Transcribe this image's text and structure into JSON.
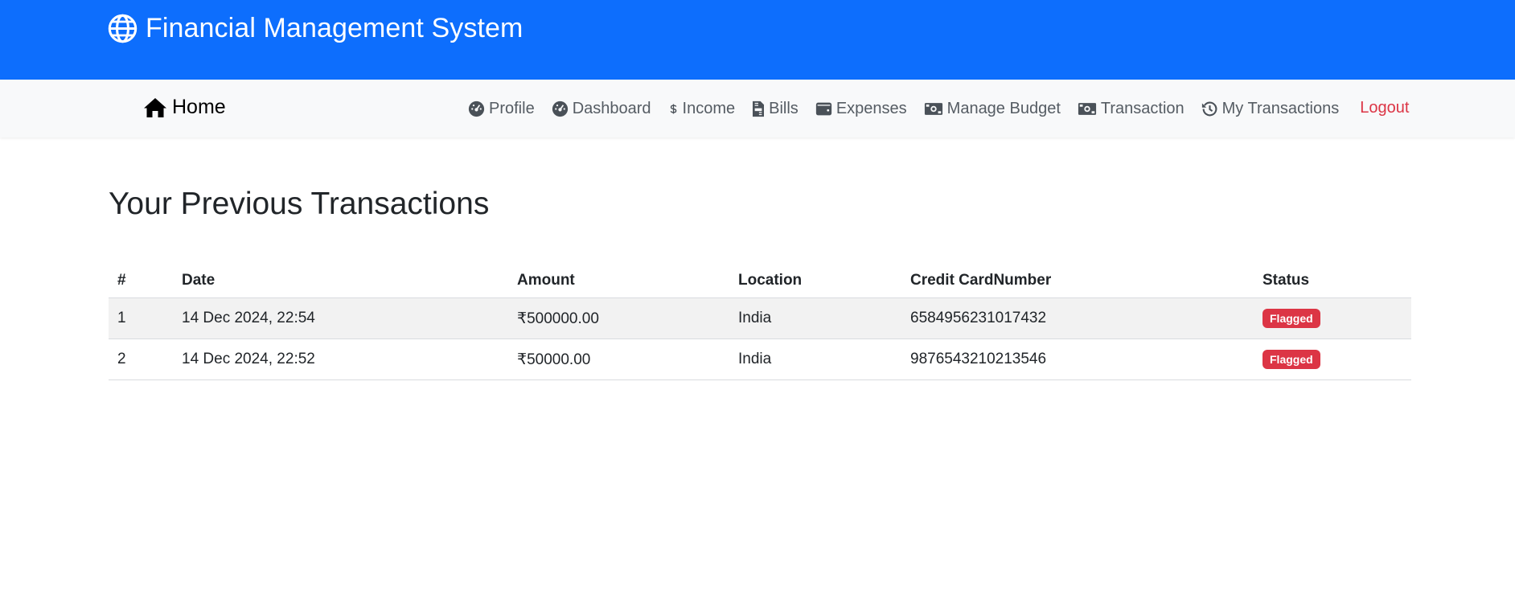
{
  "header": {
    "app_title": "Financial Management System",
    "brand_icon": "globe-icon"
  },
  "nav": {
    "home": {
      "label": "Home",
      "icon": "home-icon"
    },
    "items": [
      {
        "label": "Profile",
        "icon": "gauge-icon"
      },
      {
        "label": "Dashboard",
        "icon": "gauge-icon"
      },
      {
        "label": "Income",
        "icon": "dollar-icon"
      },
      {
        "label": "Bills",
        "icon": "invoice-icon"
      },
      {
        "label": "Expenses",
        "icon": "wallet-icon"
      },
      {
        "label": "Manage Budget",
        "icon": "money-bill-icon"
      },
      {
        "label": "Transaction",
        "icon": "money-bill-icon"
      },
      {
        "label": "My Transactions",
        "icon": "history-icon"
      }
    ],
    "logout": "Logout"
  },
  "main": {
    "title": "Your Previous Transactions",
    "table": {
      "headers": [
        "#",
        "Date",
        "Amount",
        "Location",
        "Credit CardNumber",
        "Status"
      ],
      "rows": [
        {
          "num": "1",
          "date": "14 Dec 2024, 22:54",
          "amount": "₹500000.00",
          "location": "India",
          "card": "6584956231017432",
          "status": "Flagged"
        },
        {
          "num": "2",
          "date": "14 Dec 2024, 22:52",
          "amount": "₹50000.00",
          "location": "India",
          "card": "9876543210213546",
          "status": "Flagged"
        }
      ]
    }
  },
  "colors": {
    "primary": "#0d6efd",
    "navbar_bg": "#f8f9fa",
    "danger": "#dc3545",
    "stripe": "#f2f2f2"
  }
}
